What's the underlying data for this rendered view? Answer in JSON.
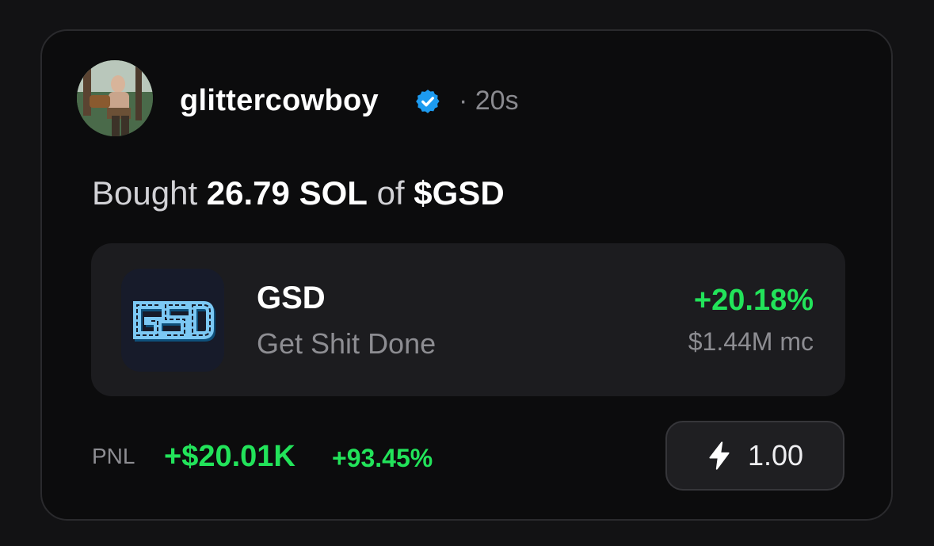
{
  "post": {
    "username": "glittercowboy",
    "time": "· 20s",
    "verified_icon": "verified-badge-icon"
  },
  "headline": {
    "prefix": "Bought",
    "amount": "26.79 SOL",
    "connector": "of",
    "ticker": "$GSD"
  },
  "token": {
    "logo_icon": "gsd-token-logo",
    "logo_text": "GSD",
    "symbol": "GSD",
    "name": "Get Shit Done",
    "change": "+20.18%",
    "market_cap": "$1.44M mc"
  },
  "pnl": {
    "label": "PNL",
    "value": "+$20.01K",
    "percent": "+93.45%"
  },
  "buy_button": {
    "icon": "lightning-bolt-icon",
    "label": "1.00"
  },
  "colors": {
    "positive": "#22e35a",
    "verified": "#1d9bf0",
    "background": "#0c0c0d",
    "panel": "#1c1c1f"
  }
}
